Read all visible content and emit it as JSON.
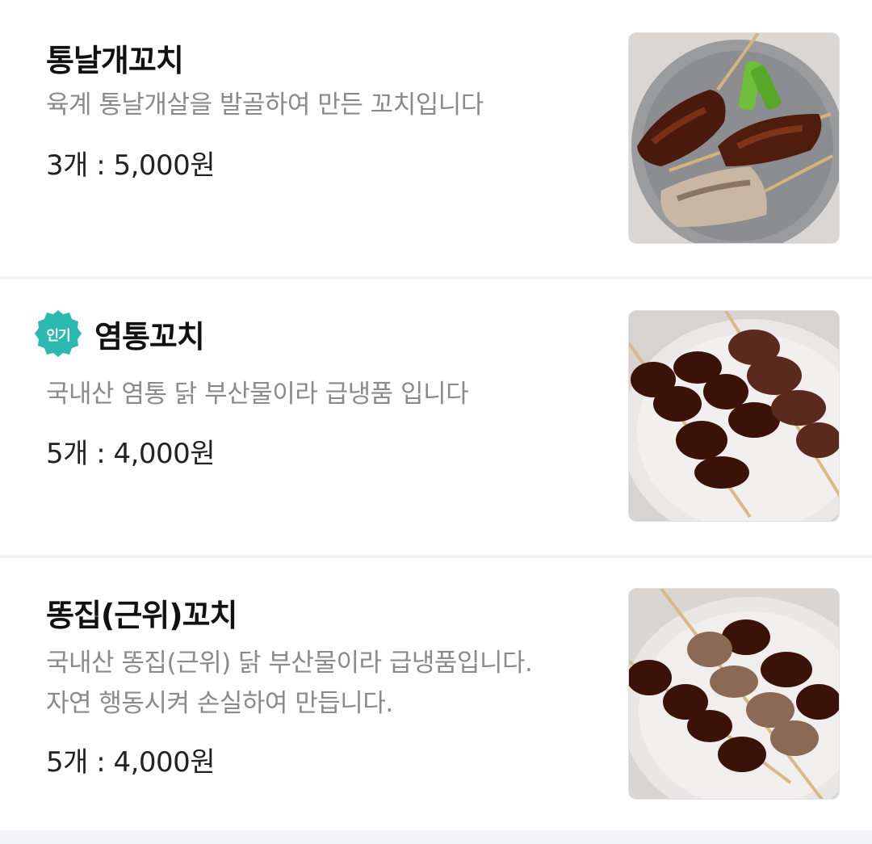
{
  "menu_items": [
    {
      "name": "통날개꼬치",
      "description": [
        "육계 통날개살을 발골하여 만든 꼬치입니다"
      ],
      "price": "3개 : 5,000원",
      "badge": "",
      "image_icon": "chicken-wing-skewer-photo"
    },
    {
      "name": "염통꼬치",
      "description": [
        "국내산 염통 닭 부산물이라 급냉품 입니다"
      ],
      "price": "5개 : 4,000원",
      "badge": "인기",
      "badge_color": "#2bb9b0",
      "image_icon": "chicken-heart-skewer-photo"
    },
    {
      "name": "똥집(근위)꼬치",
      "description": [
        "국내산 똥집(근위) 닭 부산물이라 급냉품입니다.",
        "자연 행동시켜 손실하여 만듭니다."
      ],
      "price": "5개 : 4,000원",
      "badge": "",
      "image_icon": "chicken-gizzard-skewer-photo"
    }
  ]
}
